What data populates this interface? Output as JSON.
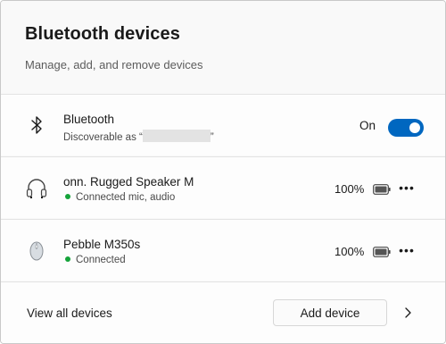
{
  "header": {
    "title": "Bluetooth devices",
    "subtitle": "Manage, add, and remove devices"
  },
  "bluetooth": {
    "icon": "bluetooth-icon",
    "title": "Bluetooth",
    "discoverable_prefix": "Discoverable as “",
    "discoverable_suffix": "”",
    "toggle_label": "On",
    "toggle_state": "on",
    "accent_color": "#0067c0"
  },
  "devices": [
    {
      "icon": "headphones-icon",
      "name": "onn. Rugged Speaker M",
      "status": "Connected mic, audio",
      "battery": "100%",
      "status_color": "#15a33a"
    },
    {
      "icon": "mouse-icon",
      "name": "Pebble M350s",
      "status": "Connected",
      "battery": "100%",
      "status_color": "#15a33a"
    }
  ],
  "footer": {
    "view_all": "View all devices",
    "add_device": "Add device"
  }
}
